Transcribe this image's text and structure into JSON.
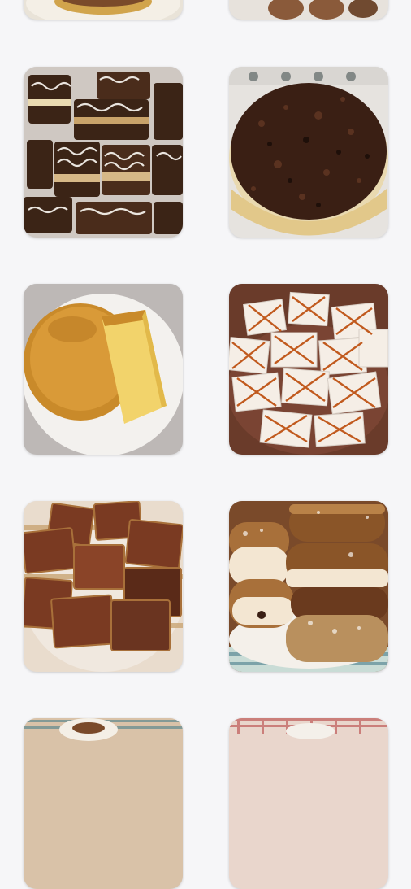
{
  "gallery": {
    "items": [
      {
        "label": "partial-cake-top-left",
        "colors": {
          "base": "#e9e3d8",
          "accent": "#7a4a2a"
        }
      },
      {
        "label": "partial-cake-top-right",
        "colors": {
          "base": "#e7e2dc",
          "accent": "#8a5a3a"
        }
      },
      {
        "label": "chocolate-layer-slices",
        "colors": {
          "base": "#3b2416",
          "accent": "#f3efe9"
        }
      },
      {
        "label": "chocolate-shaving-cheesecake",
        "colors": {
          "base": "#3a1f14",
          "accent": "#e9d9b0"
        }
      },
      {
        "label": "sponge-cake",
        "colors": {
          "base": "#c98a2a",
          "accent": "#f2d36b"
        }
      },
      {
        "label": "caramel-lattice-squares",
        "colors": {
          "base": "#6a3b2a",
          "accent": "#f5eee6"
        }
      },
      {
        "label": "honey-cake-squares",
        "colors": {
          "base": "#7a3a22",
          "accent": "#e9dccd"
        }
      },
      {
        "label": "sugar-dusted-croissants",
        "colors": {
          "base": "#7a4a2a",
          "accent": "#f3e6d2"
        }
      },
      {
        "label": "partial-cake-bottom-left",
        "colors": {
          "base": "#d9c2a8",
          "accent": "#7a4a2a"
        }
      },
      {
        "label": "partial-cake-bottom-right",
        "colors": {
          "base": "#d9b8a8",
          "accent": "#b23a3a"
        }
      }
    ]
  }
}
